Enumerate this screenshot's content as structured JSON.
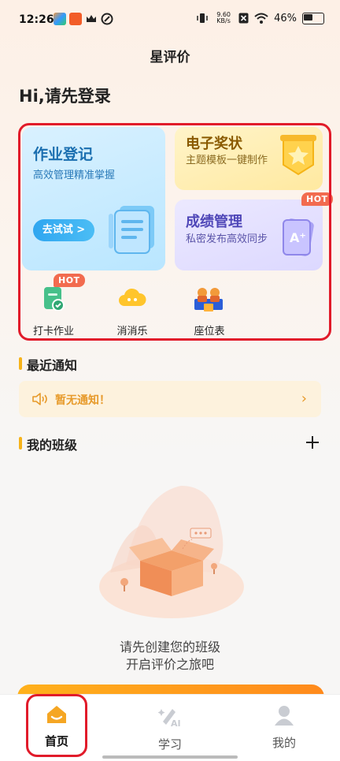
{
  "status_bar": {
    "time": "12:26",
    "speed_value": "9.60",
    "speed_unit": "KB/s",
    "battery": "46%"
  },
  "header": {
    "title": "星评价"
  },
  "greeting": "Hi,请先登录",
  "features": {
    "homework": {
      "title": "作业登记",
      "subtitle": "高效管理精准掌握",
      "button": "去试试 >"
    },
    "certificate": {
      "title": "电子奖状",
      "subtitle": "主题模板一键制作"
    },
    "grades": {
      "title": "成绩管理",
      "subtitle": "私密发布高效同步",
      "badge": "HOT"
    },
    "mini": [
      {
        "label": "打卡作业",
        "badge": "HOT",
        "icon": "checkin-icon"
      },
      {
        "label": "消消乐",
        "icon": "cloud-game-icon"
      },
      {
        "label": "座位表",
        "icon": "seating-chart-icon"
      }
    ]
  },
  "notice": {
    "section_title": "最近通知",
    "text": "暂无通知！",
    "icon": "speaker-icon"
  },
  "classes": {
    "section_title": "我的班级",
    "add_icon": "plus-icon",
    "empty_line1": "请先创建您的班级",
    "empty_line2": "开启评价之旅吧"
  },
  "nav": {
    "items": [
      {
        "label": "首页",
        "icon": "home-icon",
        "active": true
      },
      {
        "label": "学习",
        "icon": "ai-study-icon",
        "active": false
      },
      {
        "label": "我的",
        "icon": "user-icon",
        "active": false
      }
    ]
  },
  "colors": {
    "accent": "#f6b31a",
    "highlight_outline": "#e11b2a",
    "notice_text": "#e79a2a",
    "active_nav": "#f5a623"
  }
}
